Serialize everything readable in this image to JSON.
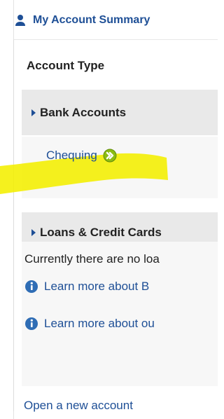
{
  "header": {
    "title": "My Account Summary",
    "icon": "user-icon"
  },
  "summary": {
    "account_type_label": "Account Type",
    "bank_accounts": {
      "label": "Bank Accounts",
      "items": [
        {
          "label": "Chequing",
          "icon": "go-arrow-icon"
        }
      ]
    },
    "loans_credit": {
      "label": "Loans & Credit Cards",
      "message": "Currently there are no loa",
      "links": [
        {
          "label": "Learn more about B",
          "icon": "info-icon"
        },
        {
          "label": "Learn more about ou",
          "icon": "info-icon"
        }
      ]
    },
    "open_account_label": "Open a new account"
  },
  "colors": {
    "link_blue": "#1e4f96",
    "section_gray": "#e9e9e9",
    "body_gray": "#f7f7f7",
    "highlight_yellow": "#f4f000",
    "go_green": "#8cbc14",
    "info_blue": "#2f6db5"
  }
}
